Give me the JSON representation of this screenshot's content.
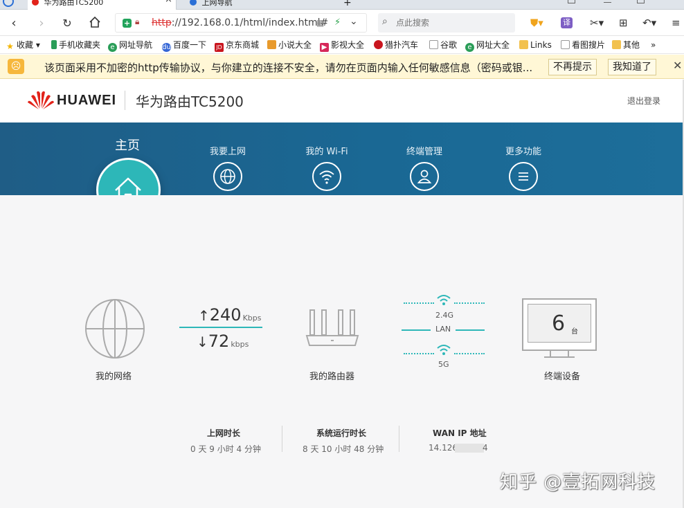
{
  "browser": {
    "tabs": [
      {
        "label": "华为路由TC5200"
      },
      {
        "label": "上网导航"
      }
    ],
    "tab_new": "+",
    "url": {
      "scheme": "http",
      "rest": "://192.168.0.1/html/index.html#"
    },
    "search": {
      "placeholder": "点此搜索"
    },
    "bookmarks": [
      {
        "label": "收藏",
        "icon": "star-icon",
        "color": "#f4b400"
      },
      {
        "label": "手机收藏夹",
        "icon": "phone-icon",
        "color": "#2a9d58"
      },
      {
        "label": "网址导航",
        "icon": "nav-icon",
        "color": "#2a9d58"
      },
      {
        "label": "百度一下",
        "icon": "baidu-icon",
        "color": "#3566d6"
      },
      {
        "label": "京东商城",
        "icon": "jd-icon",
        "color": "#c9151e"
      },
      {
        "label": "小说大全",
        "icon": "book-icon",
        "color": "#e89a2c"
      },
      {
        "label": "影视大全",
        "icon": "video-icon",
        "color": "#d6285a"
      },
      {
        "label": "猎扑汽车",
        "icon": "car-icon",
        "color": "#c9151e"
      },
      {
        "label": "谷歌",
        "icon": "page-icon",
        "color": "#999999"
      },
      {
        "label": "网址大全",
        "icon": "nav-icon",
        "color": "#2a9d58"
      },
      {
        "label": "Links",
        "icon": "folder-icon",
        "color": "#f2c14e"
      },
      {
        "label": "看图搜片",
        "icon": "page-icon",
        "color": "#999999"
      },
      {
        "label": "其他",
        "icon": "folder-icon",
        "color": "#f2c14e"
      }
    ],
    "bookmarks_more": "»",
    "warning": {
      "text": "该页面采用不加密的http传输协议，与你建立的连接不安全，请勿在页面内输入任何敏感信息（密码或银...",
      "btn_dismiss": "不再提示",
      "btn_ok": "我知道了",
      "close": "✕"
    }
  },
  "router": {
    "brand": "HUAWEI",
    "model": "华为路由TC5200",
    "logout": "退出登录",
    "nav": {
      "home": "主页",
      "items": [
        {
          "label": "我要上网",
          "icon": "globe-icon"
        },
        {
          "label": "我的 Wi-Fi",
          "icon": "wifi-icon"
        },
        {
          "label": "终端管理",
          "icon": "user-icon"
        },
        {
          "label": "更多功能",
          "icon": "menu-icon"
        }
      ]
    },
    "network": {
      "label": "我的网络"
    },
    "speed": {
      "up_arrow": "↑",
      "up": "240",
      "up_unit": "Kbps",
      "down_arrow": "↓",
      "down": "72",
      "down_unit": "kbps"
    },
    "router_label": "我的路由器",
    "links": {
      "band24": "2.4G",
      "lan": "LAN",
      "band5": "5G"
    },
    "devices": {
      "count": "6",
      "unit": "台",
      "label": "终端设备"
    },
    "stats": [
      {
        "title": "上网时长",
        "value": "0 天 9 小时 4 分钟"
      },
      {
        "title": "系统运行时长",
        "value": "8 天 10 小时 48 分钟"
      },
      {
        "title": "WAN IP 地址",
        "value_start": "14.126",
        "value_end": "4"
      }
    ]
  },
  "watermark": "知乎 @壹拓网科技",
  "colors": {
    "accent": "#2db7b8",
    "nav_band": "#1a6894",
    "huawei_red": "#e2231a"
  }
}
